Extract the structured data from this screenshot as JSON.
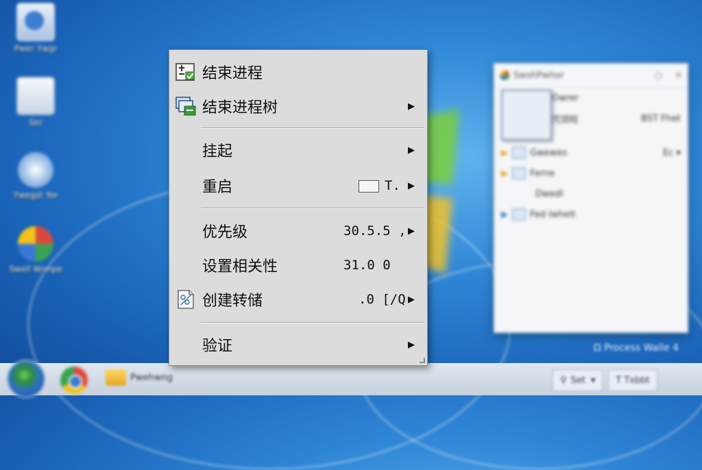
{
  "desktop": {
    "icons": [
      {
        "label": "Pwer Ywgr",
        "icon": "computer-icon"
      },
      {
        "label": "Ser",
        "icon": "document-icon"
      },
      {
        "label": "Ywegst Yor",
        "icon": "network-icon"
      },
      {
        "label": "Swell Wnnpe",
        "icon": "control-panel-icon"
      }
    ],
    "footer_text": "Ω Process Walle 4"
  },
  "background_window": {
    "title": "SwshPwhor",
    "rows": [
      {
        "label": "Owrer",
        "value": ""
      },
      {
        "label": "咒郊旺",
        "value": "BST Fhet"
      },
      {
        "label": "Gwewes",
        "value": "Ec ▾"
      },
      {
        "label": "Ferne",
        "value": ""
      },
      {
        "label": "Dwedl",
        "value": ""
      },
      {
        "label": "Fed Iwhelt",
        "value": ""
      }
    ]
  },
  "taskbar": {
    "folder_label": "Pwehwng",
    "search_label": "Set",
    "tray_label": "T Txbbt"
  },
  "context_menu": {
    "items": [
      {
        "label": "结束进程",
        "value": "",
        "has_submenu": false,
        "icon": "end-process-icon"
      },
      {
        "label": "结束进程树",
        "value": "",
        "has_submenu": true,
        "icon": "end-process-tree-icon"
      },
      {
        "label": "挂起",
        "value": "",
        "has_submenu": true,
        "icon": ""
      },
      {
        "label": "重启",
        "value": "T.",
        "has_submenu": true,
        "icon": ""
      },
      {
        "label": "优先级",
        "value": "30.5.5 ,",
        "has_submenu": true,
        "icon": ""
      },
      {
        "label": "设置相关性",
        "value": "31.0 0",
        "has_submenu": false,
        "icon": ""
      },
      {
        "label": "创建转储",
        "value": ".0 [/Q",
        "has_submenu": true,
        "icon": "create-dump-icon"
      },
      {
        "label": "验证",
        "value": "",
        "has_submenu": true,
        "icon": ""
      }
    ],
    "submenu_arrow": "▶"
  }
}
